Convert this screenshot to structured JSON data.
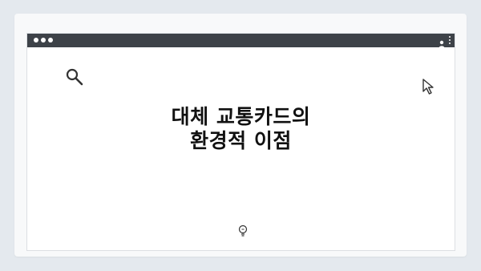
{
  "page": {
    "outer_dots": 4
  },
  "window": {
    "titlebar_color": "#3d4248",
    "traffic_lights": [
      "dot",
      "dot",
      "dot"
    ],
    "icons": {
      "user": "user-icon",
      "menu": "kebab-menu-icon",
      "search": "search-icon",
      "cursor": "cursor-arrow-icon",
      "bulb": "lightbulb-icon"
    }
  },
  "content": {
    "title_line1": "대체 교통카드의",
    "title_line2": "환경적 이점"
  },
  "colors": {
    "background": "#e4e9ee",
    "card": "#f8f9fa",
    "text": "#111111"
  }
}
